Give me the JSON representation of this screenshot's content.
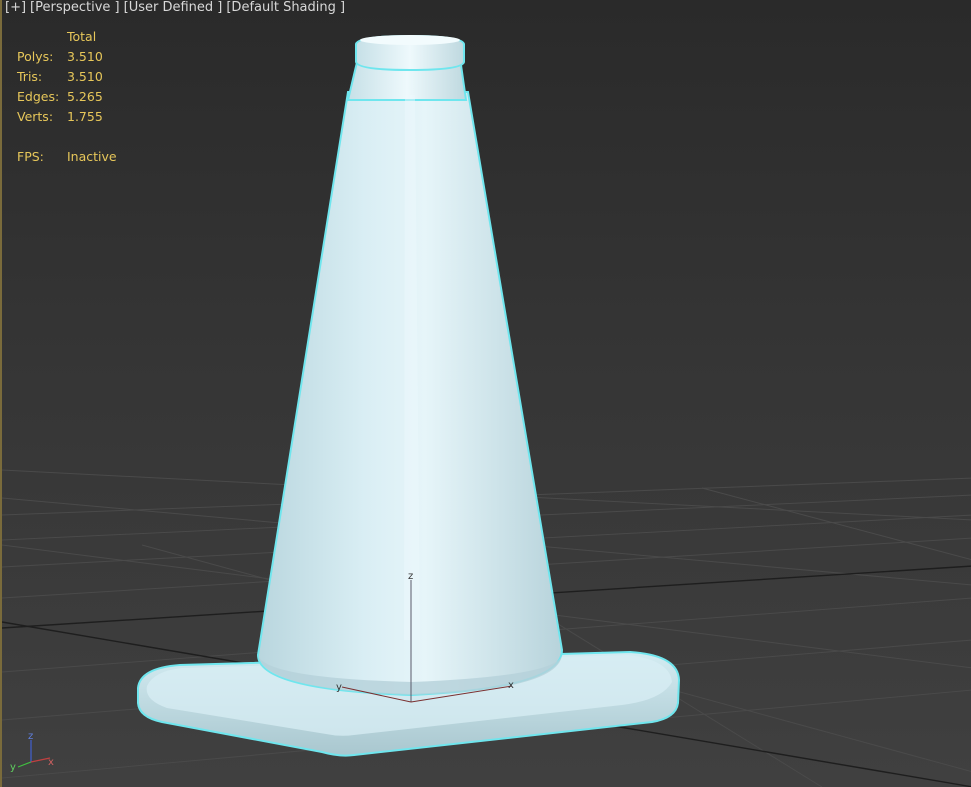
{
  "viewport": {
    "labels": [
      "[+]",
      "[Perspective ]",
      "[User Defined ]",
      "[Default Shading ]"
    ]
  },
  "stats": {
    "header": "Total",
    "rows": [
      {
        "label": "Polys:",
        "value": "3.510"
      },
      {
        "label": "Tris:",
        "value": "3.510"
      },
      {
        "label": "Edges:",
        "value": "5.265"
      },
      {
        "label": "Verts:",
        "value": "1.755"
      }
    ],
    "fps_label": "FPS:",
    "fps_value": "Inactive"
  },
  "gizmo": {
    "z": "z",
    "y": "y",
    "x": "x"
  },
  "corner_axes": {
    "z": "z",
    "y": "y",
    "x": "x"
  },
  "colors": {
    "stats_text": "#e7c75a",
    "selection_outline": "#6fe6ee",
    "cone_fill": "#cfe8ef",
    "grid_line": "#4a4a4a",
    "grid_major": "#1f1f1f",
    "axis_x": "#c04040",
    "axis_y": "#40c040",
    "axis_z": "#4060d0"
  }
}
